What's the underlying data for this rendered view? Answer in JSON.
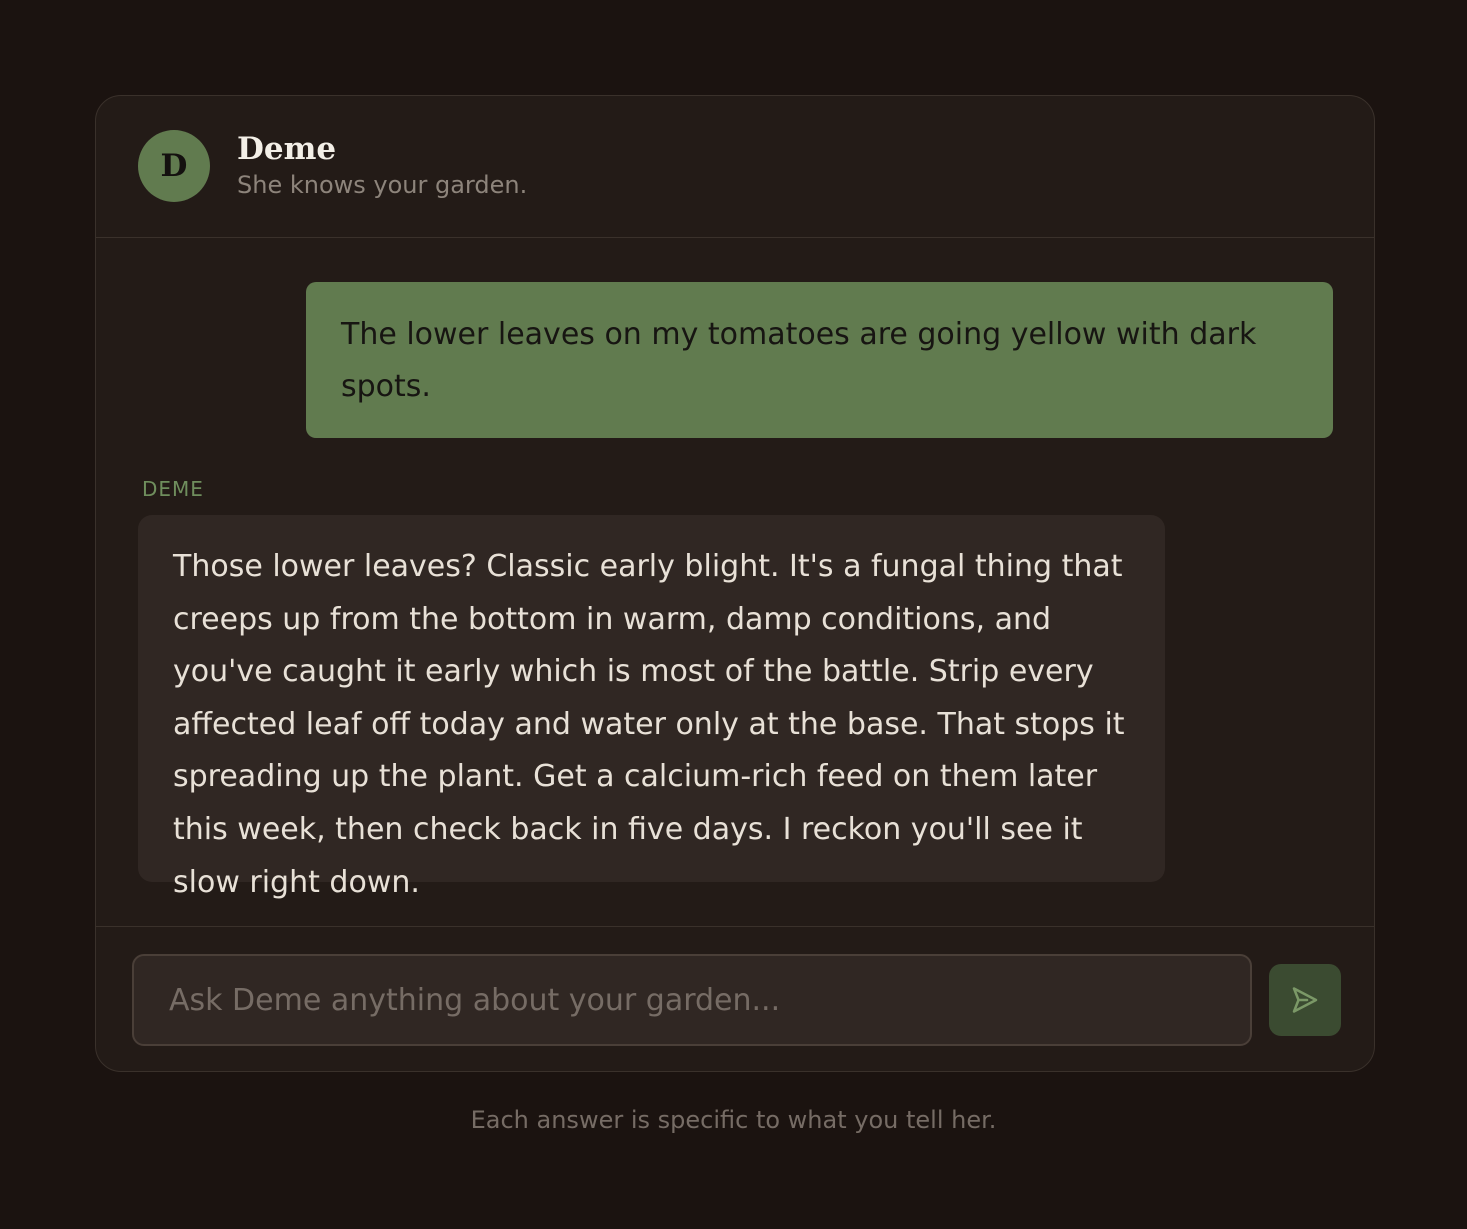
{
  "header": {
    "avatar_initial": "D",
    "name": "Deme",
    "subtitle": "She knows your garden."
  },
  "messages": [
    {
      "role": "user",
      "text": "The lower leaves on my tomatoes are going yellow with dark spots."
    },
    {
      "role": "assistant",
      "sender_label": "DEME",
      "text": "Those lower leaves? Classic early blight. It's a fungal thing that creeps up from the bottom in warm, damp conditions, and you've caught it early which is most of the battle. Strip every affected leaf off today and water only at the base. That stops it spreading up the plant. Get a calcium-rich feed on them later this week, then check back in five days. I reckon you'll see it slow right down."
    }
  ],
  "composer": {
    "value": "",
    "placeholder": "Ask Deme anything about your garden...",
    "send_icon": "send-icon",
    "send_button_label": "Send"
  },
  "footer_note": "Each answer is specific to what you tell her.",
  "colors": {
    "page_background": "#1b1310",
    "card_background": "#231b17",
    "border": "#3a312b",
    "accent_green": "#617b4f",
    "assistant_bubble": "#302723",
    "send_button": "#3b4b31",
    "primary_text": "#f3efe7",
    "muted_text": "#8d847b"
  }
}
